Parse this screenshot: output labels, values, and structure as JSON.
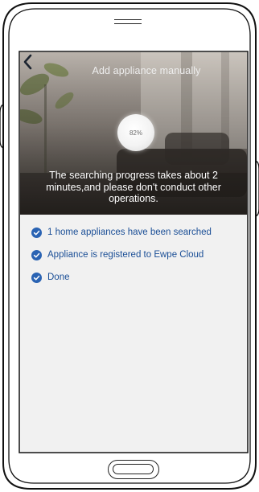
{
  "header": {
    "title": "Add appliance manually",
    "back_icon": "chevron-left-icon"
  },
  "progress": {
    "label": "82%",
    "value_percent": 82
  },
  "hint": {
    "text": "The searching progress takes about 2 minutes,and please don't conduct other operations."
  },
  "status_items": [
    {
      "label": "1 home appliances have been searched",
      "icon": "check-circle-icon"
    },
    {
      "label": "Appliance is registered to Ewpe Cloud",
      "icon": "check-circle-icon"
    },
    {
      "label": "Done",
      "icon": "check-circle-icon"
    }
  ],
  "colors": {
    "accent": "#2a63b3",
    "status_text": "#1a4e96",
    "screen_background": "#f1f1f1"
  }
}
